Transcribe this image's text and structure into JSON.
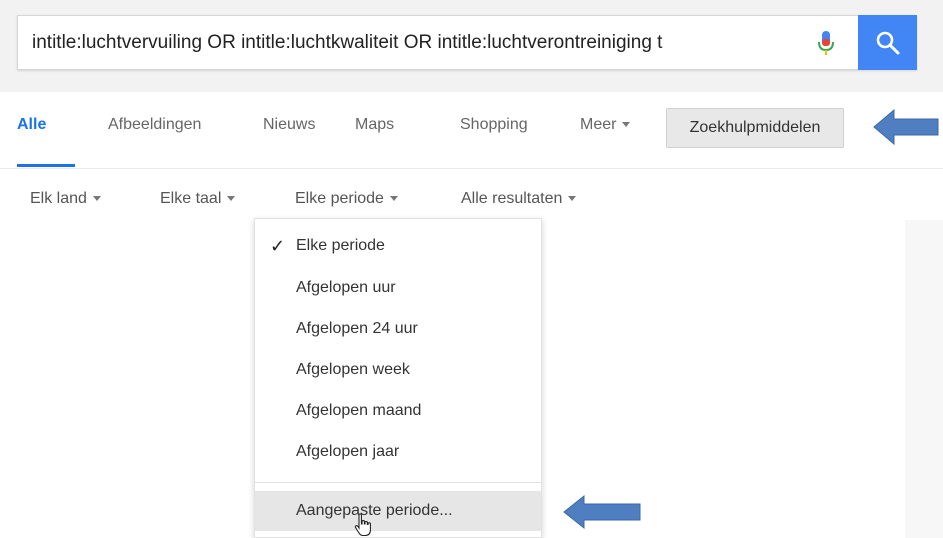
{
  "search": {
    "query": "intitle:luchtvervuiling OR intitle:luchtkwaliteit OR intitle:luchtverontreiniging t"
  },
  "icons": {
    "mic": "microphone-icon",
    "search": "search-icon",
    "caret": "caret-down-icon",
    "check": "checkmark-icon",
    "arrow": "arrow-left-icon",
    "cursor": "hand-pointer-icon"
  },
  "colors": {
    "accent": "#1a73e8",
    "search_button": "#4285f4",
    "annotation_arrow": "#4f7fc0"
  },
  "tabs": [
    {
      "label": "Alle",
      "active": true
    },
    {
      "label": "Afbeeldingen",
      "active": false
    },
    {
      "label": "Nieuws",
      "active": false
    },
    {
      "label": "Maps",
      "active": false
    },
    {
      "label": "Shopping",
      "active": false
    },
    {
      "label": "Meer",
      "active": false
    }
  ],
  "tools_button": {
    "label": "Zoekhulpmiddelen"
  },
  "tools": [
    {
      "label": "Elk land"
    },
    {
      "label": "Elke taal"
    },
    {
      "label": "Elke periode"
    },
    {
      "label": "Alle resultaten"
    }
  ],
  "dropdown": {
    "items": [
      {
        "label": "Elke periode",
        "checked": true
      },
      {
        "label": "Afgelopen uur"
      },
      {
        "label": "Afgelopen 24 uur"
      },
      {
        "label": "Afgelopen week"
      },
      {
        "label": "Afgelopen maand"
      },
      {
        "label": "Afgelopen jaar"
      }
    ],
    "custom": {
      "label": "Aangepaste periode..."
    }
  }
}
